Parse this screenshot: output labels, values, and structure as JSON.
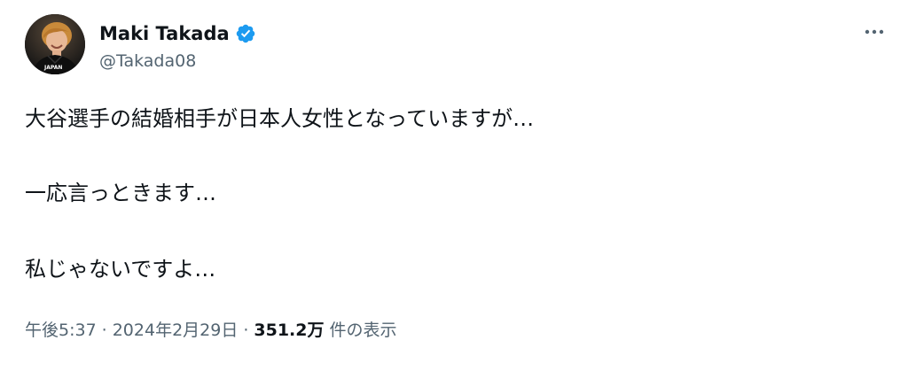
{
  "tweet": {
    "author": {
      "display_name": "Maki Takada",
      "handle": "@Takada08",
      "verified": true,
      "avatar_jersey_text": "JAPAN"
    },
    "text_lines": [
      "大谷選手の結婚相手が日本人女性となっていますが…",
      "一応言っときます…",
      "私じゃないですよ…"
    ],
    "meta": {
      "time": "午後5:37",
      "separator": "·",
      "date": "2024年2月29日",
      "views_count": "351.2万",
      "views_label": "件の表示"
    },
    "icons": {
      "verified": "verified-badge-icon",
      "more": "more-options-icon"
    },
    "colors": {
      "text": "#0f1419",
      "secondary_text": "#536471",
      "verified": "#1d9bf0",
      "background": "#ffffff"
    }
  }
}
